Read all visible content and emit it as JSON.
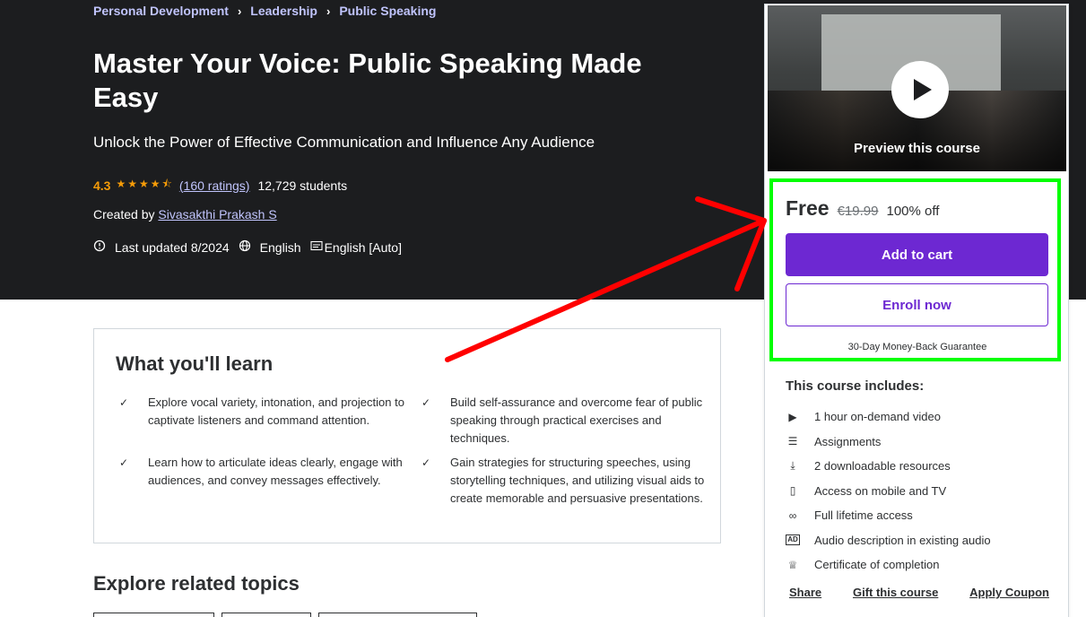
{
  "breadcrumb": [
    "Personal Development",
    "Leadership",
    "Public Speaking"
  ],
  "course": {
    "title": "Master Your Voice: Public Speaking Made Easy",
    "subtitle": "Unlock the Power of Effective Communication and Influence Any Audience",
    "rating": "4.3",
    "stars": "★★★★⯪",
    "ratings_count": "(160 ratings)",
    "students": "12,729 students",
    "created_by_label": "Created by",
    "author": "Sivasakthi Prakash S",
    "last_updated": "Last updated 8/2024",
    "language": "English",
    "captions": "English [Auto]"
  },
  "sidebar": {
    "preview_label": "Preview this course",
    "price": "Free",
    "original_price": "€19.99",
    "discount": "100% off",
    "add_to_cart": "Add to cart",
    "enroll_now": "Enroll now",
    "guarantee": "30-Day Money-Back Guarantee",
    "includes_title": "This course includes:",
    "includes": [
      {
        "icon": "video-icon",
        "text": "1 hour on-demand video"
      },
      {
        "icon": "assignment-icon",
        "text": "Assignments"
      },
      {
        "icon": "download-icon",
        "text": "2 downloadable resources"
      },
      {
        "icon": "mobile-icon",
        "text": "Access on mobile and TV"
      },
      {
        "icon": "infinity-icon",
        "text": "Full lifetime access"
      },
      {
        "icon": "audio-description-icon",
        "text": "Audio description in existing audio"
      },
      {
        "icon": "trophy-icon",
        "text": "Certificate of completion"
      }
    ],
    "share": "Share",
    "gift": "Gift this course",
    "coupon": "Apply Coupon"
  },
  "learn": {
    "title": "What you'll learn",
    "items": [
      "Explore vocal variety, intonation, and projection to captivate listeners and command attention.",
      "Build self-assurance and overcome fear of public speaking through practical exercises and techniques.",
      "Learn how to articulate ideas clearly, engage with audiences, and convey messages effectively.",
      "Gain strategies for structuring speeches, using storytelling techniques, and utilizing visual aids to create memorable and persuasive presentations."
    ]
  },
  "related": {
    "title": "Explore related topics"
  },
  "colors": {
    "hero_bg": "#1c1d1f",
    "accent": "#6d28d2",
    "link": "#c0c4fc",
    "star": "#f69c08",
    "highlight_box": "#00ff00",
    "annotation_arrow": "#ff0000"
  }
}
